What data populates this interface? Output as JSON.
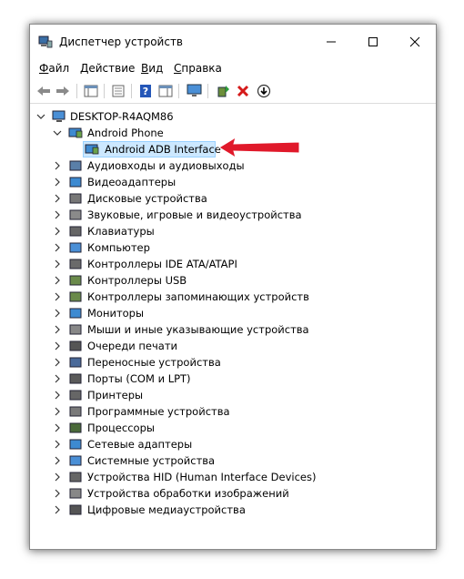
{
  "window": {
    "title": "Диспетчер устройств"
  },
  "menu": {
    "file": "Файл",
    "file_key": "Ф",
    "file_rest": "айл",
    "action_key": "Д",
    "action_rest": "ействие",
    "view_key": "В",
    "view_rest": "ид",
    "help_key": "С",
    "help_rest": "правка"
  },
  "tree": {
    "root": "DESKTOP-R4AQM86",
    "expanded": {
      "label": "Android Phone",
      "child": "Android ADB Interface"
    },
    "categories": [
      "Аудиовходы и аудиовыходы",
      "Видеоадаптеры",
      "Дисковые устройства",
      "Звуковые, игровые и видеоустройства",
      "Клавиатуры",
      "Компьютер",
      "Контроллеры IDE ATA/ATAPI",
      "Контроллеры USB",
      "Контроллеры запоминающих устройств",
      "Мониторы",
      "Мыши и иные указывающие устройства",
      "Очереди печати",
      "Переносные устройства",
      "Порты (COM и LPT)",
      "Принтеры",
      "Программные устройства",
      "Процессоры",
      "Сетевые адаптеры",
      "Системные устройства",
      "Устройства HID (Human Interface Devices)",
      "Устройства обработки изображений",
      "Цифровые медиаустройства"
    ]
  },
  "colors": {
    "selection": "#cce8ff",
    "arrow": "#e0192a"
  }
}
